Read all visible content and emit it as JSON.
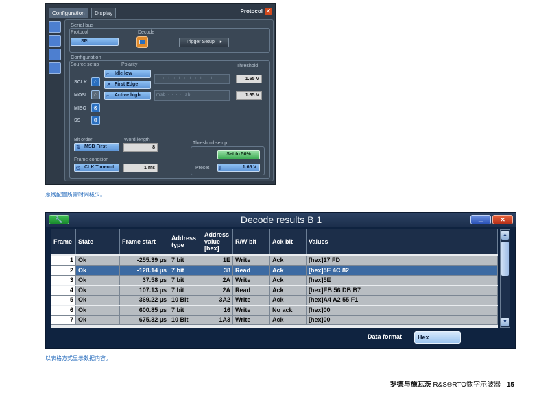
{
  "protocol_window": {
    "tabs": [
      "Configuration",
      "Display"
    ],
    "title": "Protocol",
    "close": "✕",
    "serial_bus": {
      "section": "Serial bus",
      "protocol_label": "Protocol",
      "protocol_value": "SPI",
      "decode_label": "Decode",
      "trigger_setup": "Trigger Setup"
    },
    "configuration": {
      "section": "Configuration",
      "source_setup": "Source setup",
      "polarity": "Polarity",
      "threshold": "Threshold",
      "signals": [
        "SCLK",
        "MOSI",
        "MISO",
        "SS"
      ],
      "sclk_polarity": "Idle low",
      "sclk_edge": "First Edge",
      "mosi_polarity": "Active high",
      "sclk_threshold": "1.65 V",
      "mosi_threshold": "1.65 V",
      "mosi_wave": "msb  ·  ·  ·  ·  lsb"
    },
    "bit_order_label": "Bit order",
    "bit_order_value": "MSB First",
    "word_length_label": "Word length",
    "word_length_value": "8",
    "frame_condition_label": "Frame condition",
    "frame_condition_value": "CLK Timeout",
    "frame_timeout_value": "1 ms",
    "threshold_setup": "Threshold setup",
    "set_to_50": "Set to 50%",
    "preset_label": "Preset",
    "preset_value": "1.65 V"
  },
  "caption_1": "总线配置所需时间极少。",
  "decode_window": {
    "title": "Decode results B 1",
    "columns": [
      "Frame",
      "State",
      "Frame start",
      "Address type",
      "Address value [hex]",
      "R/W bit",
      "Ack bit",
      "Values"
    ],
    "rows": [
      {
        "frame": "1",
        "state": "Ok",
        "start": "-255.39 µs",
        "addr_type": "7 bit",
        "addr_val": "1E",
        "rw": "Write",
        "ack": "Ack",
        "values": "[hex]17 FD"
      },
      {
        "frame": "2",
        "state": "Ok",
        "start": "-128.14 µs",
        "addr_type": "7 bit",
        "addr_val": "38",
        "rw": "Read",
        "ack": "Ack",
        "values": "[hex]5E 4C 82"
      },
      {
        "frame": "3",
        "state": "Ok",
        "start": "37.58 µs",
        "addr_type": "7 bit",
        "addr_val": "2A",
        "rw": "Write",
        "ack": "Ack",
        "values": "[hex]5E"
      },
      {
        "frame": "4",
        "state": "Ok",
        "start": "107.13 µs",
        "addr_type": "7 bit",
        "addr_val": "2A",
        "rw": "Read",
        "ack": "Ack",
        "values": "[hex]EB 56 DB B7"
      },
      {
        "frame": "5",
        "state": "Ok",
        "start": "369.22 µs",
        "addr_type": "10 Bit",
        "addr_val": "3A2",
        "rw": "Write",
        "ack": "Ack",
        "values": "[hex]A4 A2 55 F1"
      },
      {
        "frame": "6",
        "state": "Ok",
        "start": "600.85 µs",
        "addr_type": "7 bit",
        "addr_val": "16",
        "rw": "Write",
        "ack": "No ack",
        "values": "[hex]00"
      },
      {
        "frame": "7",
        "state": "Ok",
        "start": "675.32 µs",
        "addr_type": "10 Bit",
        "addr_val": "1A3",
        "rw": "Write",
        "ack": "Ack",
        "values": "[hex]00"
      }
    ],
    "selected_row": 2,
    "data_format_label": "Data format",
    "data_format_value": "Hex"
  },
  "caption_2": "以表格方式显示数据内容。",
  "footer": {
    "brand": "罗德与施瓦茨",
    "product": "R&S®RTO数字示波器",
    "page": "15"
  }
}
